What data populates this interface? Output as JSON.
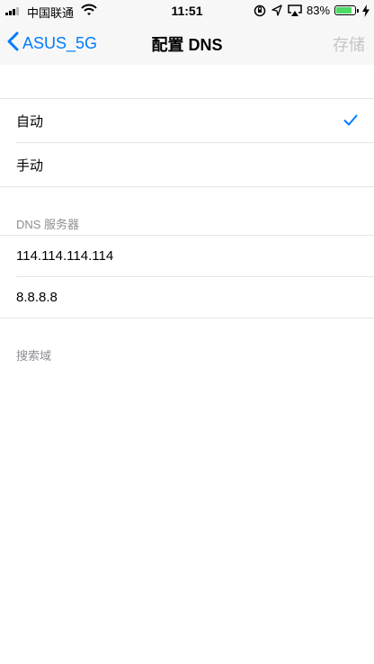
{
  "status_bar": {
    "carrier": "中国联通",
    "time": "11:51",
    "battery_percent_text": "83%",
    "battery_level": 0.83
  },
  "nav": {
    "back_label": "ASUS_5G",
    "title": "配置 DNS",
    "save_label": "存储"
  },
  "dns_mode": {
    "options": [
      {
        "label": "自动",
        "selected": true
      },
      {
        "label": "手动",
        "selected": false
      }
    ]
  },
  "dns_servers": {
    "header": "DNS 服务器",
    "servers": [
      "114.114.114.114",
      "8.8.8.8"
    ]
  },
  "search_domains": {
    "header": "搜索域"
  },
  "colors": {
    "accent": "#007aff",
    "disabled": "#c4c4c6",
    "section_header": "#8e8e93",
    "battery": "#4cd964"
  }
}
